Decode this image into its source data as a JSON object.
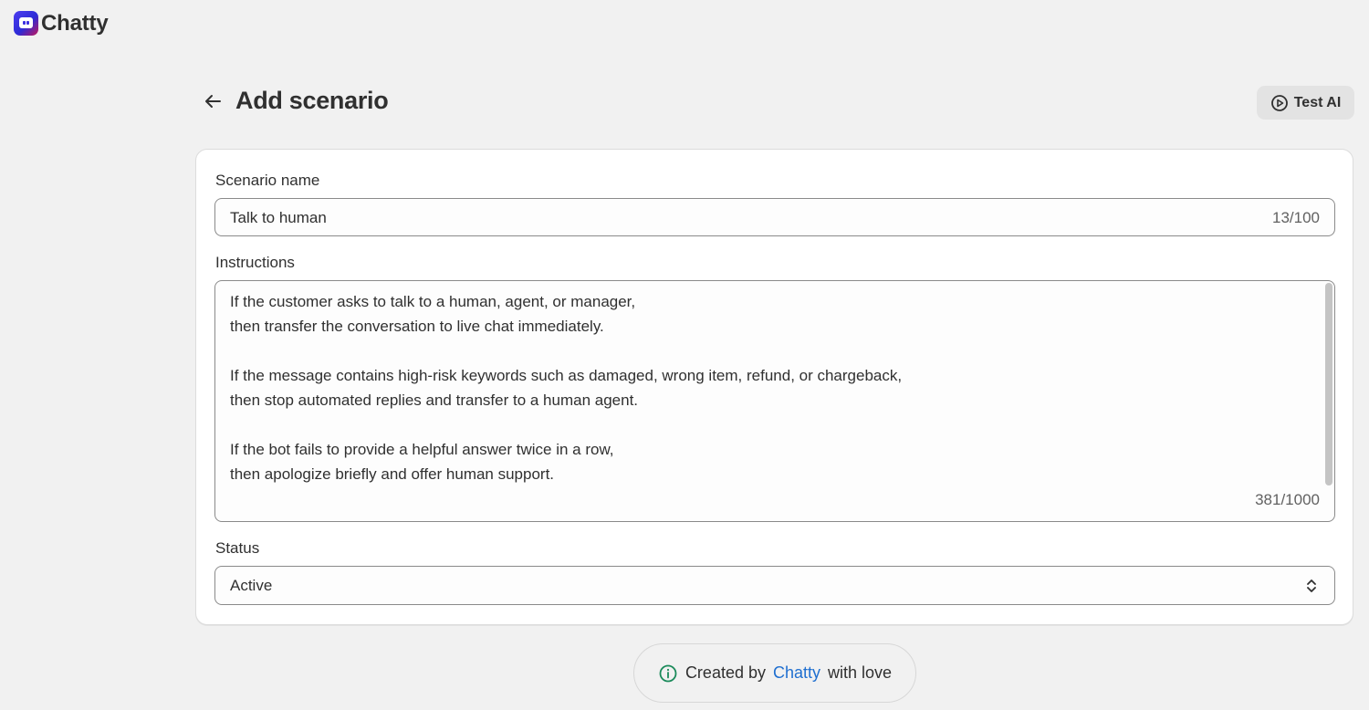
{
  "app": {
    "brand": "Chatty"
  },
  "header": {
    "title": "Add scenario",
    "test_button_label": "Test AI"
  },
  "form": {
    "scenario_name": {
      "label": "Scenario name",
      "value": "Talk to human",
      "counter": "13/100"
    },
    "instructions": {
      "label": "Instructions",
      "value": "If the customer asks to talk to a human, agent, or manager,\nthen transfer the conversation to live chat immediately.\n\nIf the message contains high-risk keywords such as damaged, wrong item, refund, or chargeback,\nthen stop automated replies and transfer to a human agent.\n\nIf the bot fails to provide a helpful answer twice in a row,\nthen apologize briefly and offer human support.",
      "counter": "381/1000"
    },
    "status": {
      "label": "Status",
      "value": "Active"
    }
  },
  "footer": {
    "prefix": "Created by",
    "link": "Chatty",
    "suffix": "with love"
  },
  "colors": {
    "background": "#f1f1f1",
    "link": "#1f6fd0",
    "info_icon": "#1a8a5a"
  },
  "icons": {
    "back": "arrow-left-icon",
    "test": "play-circle-icon",
    "select": "chevron-up-down-icon",
    "info": "info-circle-icon"
  }
}
